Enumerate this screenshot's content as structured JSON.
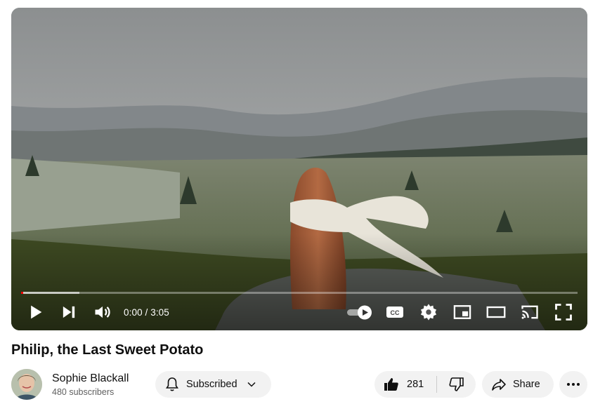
{
  "video": {
    "title": "Philip, the Last Sweet Potato",
    "current_time": "0:00",
    "duration": "3:05",
    "time_display": "0:00 / 3:05",
    "played_fraction": 0.002,
    "buffered_fraction": 0.105
  },
  "player": {
    "controls": [
      {
        "name": "play",
        "icon": "play-icon"
      },
      {
        "name": "next",
        "icon": "next-icon"
      },
      {
        "name": "volume",
        "icon": "volume-icon"
      }
    ],
    "right_controls": [
      "autoplay-toggle-icon",
      "captions-icon",
      "settings-icon",
      "miniplayer-icon",
      "theater-mode-icon",
      "cast-icon",
      "fullscreen-icon"
    ],
    "captions_label": "CC"
  },
  "channel": {
    "name": "Sophie Blackall",
    "subscribers": "480 subscribers",
    "subscribe_label": "Subscribed"
  },
  "actions": {
    "like_count": "281",
    "share_label": "Share"
  },
  "colors": {
    "progress": "#ff0000",
    "pill_bg": "#f2f2f2",
    "text": "#0f0f0f",
    "subtext": "#606060"
  }
}
